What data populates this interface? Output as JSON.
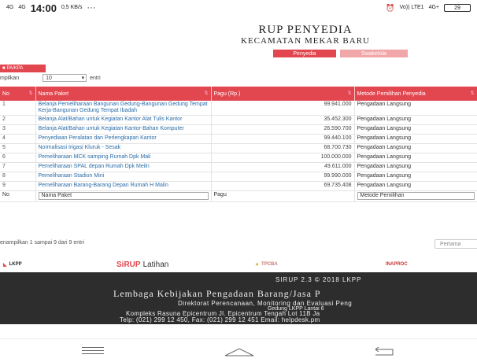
{
  "statusbar": {
    "carrier1": "4G",
    "carrier2": "4G",
    "time": "14:00",
    "speed": "0,5 KB/s",
    "dots": "···",
    "volte": "Vo)) LTE1",
    "signal": "4G+",
    "battery": "29"
  },
  "header": {
    "title": "RUP PENYEDIA",
    "subtitle": "KECAMATAN MEKAR BARU",
    "tab_penyedia": "Penyedia",
    "tab_swakelola": "Swakelola"
  },
  "controls": {
    "pakpa_label": "PA/KPA",
    "show_prefix": "mpilkan",
    "length_value": "10",
    "length_suffix": "entri"
  },
  "table": {
    "headers": {
      "no": "No",
      "paket": "Nama Paket",
      "pagu": "Pagu (Rp.)",
      "metode": "Metode Pemilihan Penyedia"
    },
    "rows": [
      {
        "no": "1",
        "paket": "Belanja Pemeliharaan Bangunan Gedung-Bangunan Gedung Tempat Kerja-Bangunan Gedung Tempat Ibadah",
        "pagu": "99.941.000",
        "metode": "Pengadaan Langsung"
      },
      {
        "no": "2",
        "paket": "Belanja Alat/Bahan untuk Kegiatan Kantor Alat Tulis Kantor",
        "pagu": "35.452.300",
        "metode": "Pengadaan Langsung"
      },
      {
        "no": "3",
        "paket": "Belanja Alat/Bahan untuk Kegiatan Kantor-Bahan Komputer",
        "pagu": "26.590.700",
        "metode": "Pengadaan Langsung"
      },
      {
        "no": "4",
        "paket": "Penyediaan Peralatan dan Perlengkapan Kantor",
        "pagu": "99.440.100",
        "metode": "Pengadaan Langsung"
      },
      {
        "no": "5",
        "paket": "Normalisasi Irigasi Kluruk - Sesak",
        "pagu": "68.700.730",
        "metode": "Pengadaan Langsung"
      },
      {
        "no": "6",
        "paket": "Pemeliharaan MCK samping Rumah Dpk Mali",
        "pagu": "100.000.000",
        "metode": "Pengadaan Langsung"
      },
      {
        "no": "7",
        "paket": "Pemeliharaan SPAL depan Rumah Dpk Meiln",
        "pagu": "49.611.000",
        "metode": "Pengadaan Langsung"
      },
      {
        "no": "8",
        "paket": "Pemeliharaan Stadion Mini",
        "pagu": "99.990.000",
        "metode": "Pengadaan Langsung"
      },
      {
        "no": "9",
        "paket": "Pemeliharaan Barang-Barang Depan Rumah H Malin",
        "pagu": "69.735.408",
        "metode": "Pengadaan Langsung"
      }
    ],
    "footer": {
      "no": "No",
      "paket_placeholder": "Nama Paket",
      "pagu": "Pagu",
      "metode_placeholder": "Metode Pemilihan"
    }
  },
  "info": {
    "showing": "enampilkan 1 sampai 9 dari 9 entri",
    "pager_first": "Pertama"
  },
  "logos": {
    "lkpp": "LKPP",
    "sirup_brand": "SiRUP",
    "sirup_suffix": "Latihan",
    "tpcba": "TPCBA",
    "inaproc": "INAPROC"
  },
  "footer": {
    "version": "SIRUP 2.3 © 2018 LKPP",
    "org": "Lembaga Kebijakan Pengadaan Barang/Jasa P",
    "line1": "Direktorat Perencanaan, Monitoring dan Evaluasi Peng",
    "line2": "Gedung LKPP Lantai 6",
    "line3": "Kompleks Rasuna Epicentrum Jl. Epicentrum Tengah Lot 11B Ja",
    "line4": "Telp: (021) 299 12 450, Fax: (021) 299 12 451 Email: helpdesk.pm"
  },
  "colors": {
    "accent": "#e2474f",
    "accent_light": "#f1a6a9",
    "footer_bg": "#2d2d2d",
    "link": "#2a6ca8"
  }
}
